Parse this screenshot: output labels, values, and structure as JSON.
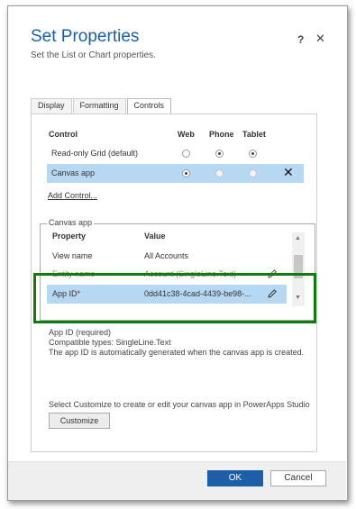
{
  "dialog": {
    "title": "Set Properties",
    "subtitle": "Set the List or Chart properties.",
    "help_label": "?",
    "close_label": "✕"
  },
  "tabs": [
    {
      "label": "Display",
      "active": false
    },
    {
      "label": "Formatting",
      "active": false
    },
    {
      "label": "Controls",
      "active": true
    }
  ],
  "controls_grid": {
    "headers": {
      "control": "Control",
      "web": "Web",
      "phone": "Phone",
      "tablet": "Tablet"
    },
    "rows": [
      {
        "label": "Read-only Grid (default)",
        "web": "unselected",
        "phone": "selected",
        "tablet": "selected"
      },
      {
        "label": "Canvas app",
        "web": "selected",
        "phone": "disabled",
        "tablet": "disabled",
        "delete_label": "✕"
      }
    ],
    "add_control_label": "Add Control..."
  },
  "canvas_app": {
    "legend": "Canvas app",
    "headers": {
      "property": "Property",
      "value": "Value"
    },
    "rows": [
      {
        "property": "View name",
        "value": "All Accounts"
      },
      {
        "property": "Entity name",
        "value": "Account (SingleLine.Text)"
      },
      {
        "property": "App ID",
        "required_mark": "*",
        "value": "0dd41c38-4cad-4439-be98-..."
      }
    ],
    "info_lines": [
      "App ID (required)",
      "Compatible types: SingleLine.Text",
      "The app ID is automatically generated when the canvas app is created."
    ],
    "customize_text": "Select Customize to create or edit your canvas app in PowerApps Studio",
    "customize_label": "Customize"
  },
  "footer": {
    "ok_label": "OK",
    "cancel_label": "Cancel"
  },
  "colors": {
    "accent": "#1c5fa8",
    "highlight_box": "#107c10",
    "selected_row": "#b7d8f3"
  }
}
